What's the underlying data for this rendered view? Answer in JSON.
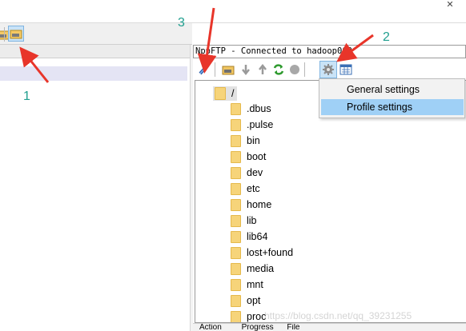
{
  "window": {
    "close_glyph": "✕"
  },
  "status_line": "NppFTP - Connected to hadoop003",
  "menu": {
    "items": [
      {
        "label": "General settings"
      },
      {
        "label": "Profile settings"
      }
    ]
  },
  "tree": {
    "root": "/",
    "folders": [
      ".dbus",
      ".pulse",
      "bin",
      "boot",
      "dev",
      "etc",
      "home",
      "lib",
      "lib64",
      "lost+found",
      "media",
      "mnt",
      "opt",
      "proc"
    ]
  },
  "bottom_columns": [
    "Action",
    "Progress",
    "File"
  ],
  "annotations": {
    "a1": "1",
    "a2": "2",
    "a3": "3"
  },
  "watermark": "https://blog.csdn.net/qq_39231255",
  "colors": {
    "annotation_arrow": "#e8352a",
    "annotation_text": "#1f9e8e",
    "menu_hover": "#9fd0f6",
    "folder": "#f6d47a"
  },
  "icons": {
    "left_toolbar": [
      "folder-icon",
      "open-folder-icon"
    ],
    "right_toolbar": [
      "connect-icon",
      "folder-icon",
      "download-icon",
      "upload-icon",
      "refresh-icon",
      "stop-icon",
      "settings-icon",
      "message-log-icon"
    ]
  }
}
